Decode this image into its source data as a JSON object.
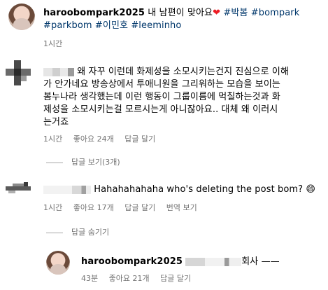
{
  "post": {
    "username": "haroobompark2025",
    "caption": "내 남편이 맞아요",
    "heart_emoji": "❤",
    "tags_line1": [
      "#박봄",
      "#bompark"
    ],
    "tags_line2": [
      "#parkbom",
      "#이민호",
      "#leeminho"
    ],
    "time": "1시간"
  },
  "comments": [
    {
      "text_lines": [
        "왜 자꾸 이런데 화제성을 소모시키는건지 진심으로 이해",
        "가 안가네요 방송상에서 투애니원을 그리워하는 모습을 보이는",
        "봄누나라 생각했는데 이런 행동이 그룹이름에 먹칠하는것과 화",
        "제성을 소모시키는걸 모르시는게 아니잖아요.. 대체 왜 이러시",
        "는거죠"
      ],
      "time": "1시간",
      "likes": "좋아요 24개",
      "reply": "답글 달기",
      "view_replies": "답글 보기(3개)"
    },
    {
      "text": "Hahahahahaha who's deleting the post bom?",
      "emoji": "😄",
      "time": "1시간",
      "likes": "좋아요 17개",
      "reply": "답글 달기",
      "translate": "번역 보기",
      "hide_replies": "답글 숨기기"
    }
  ],
  "reply": {
    "username": "haroobompark2025",
    "text": "회사 ——",
    "time": "43분",
    "likes": "좋아요 21개",
    "reply": "답글 달기"
  },
  "colors": {
    "tag": "#00376b",
    "meta": "#737373",
    "heart": "#ed1c24"
  }
}
